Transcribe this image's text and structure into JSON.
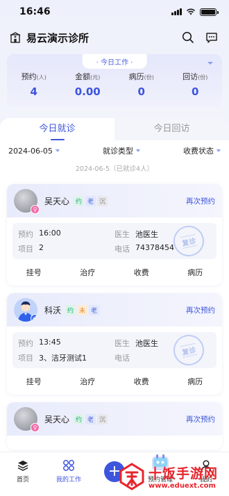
{
  "status_bar": {
    "time": "16:46"
  },
  "header": {
    "clinic_name": "易云演示诊所"
  },
  "summary": {
    "tag": "· 今日工作 ·",
    "stats": [
      {
        "label": "预约",
        "unit": "(人)",
        "value": "4"
      },
      {
        "label": "金额",
        "unit": "(元)",
        "value": "0.00"
      },
      {
        "label": "病历",
        "unit": "(份)",
        "value": "0"
      },
      {
        "label": "回访",
        "unit": "(份)",
        "value": "0"
      }
    ]
  },
  "tabs": [
    {
      "label": "今日就诊"
    },
    {
      "label": "今日回访"
    }
  ],
  "filters": {
    "date": "2024-06-05",
    "visit_type": "就诊类型",
    "charge_status": "收费状态"
  },
  "date_summary": "2024-06-5（已就诊4人）",
  "appointments": [
    {
      "name": "吴天心",
      "gender": "female",
      "tags": [
        "约",
        "老",
        "沉"
      ],
      "rebook": "再次预约",
      "labels": {
        "appt": "预约",
        "doctor": "医生",
        "item": "项目",
        "phone": "电话"
      },
      "appt_time": "16:00",
      "doctor": "池医生",
      "item": "2",
      "phone": "74378454",
      "stamp": "复诊",
      "actions": [
        "挂号",
        "治疗",
        "收费",
        "病历"
      ]
    },
    {
      "name": "科沃",
      "gender": "male",
      "tags": [
        "约",
        "未",
        "老"
      ],
      "rebook": "再次预约",
      "labels": {
        "appt": "预约",
        "doctor": "医生",
        "item": "项目",
        "phone": "电话"
      },
      "appt_time": "13:45",
      "doctor": "池医生",
      "item": "3、洁牙测试1",
      "phone": "",
      "stamp": "复诊",
      "actions": [
        "挂号",
        "治疗",
        "收费",
        "病历"
      ]
    },
    {
      "name": "吴天心",
      "gender": "female",
      "tags": [
        "约",
        "老",
        "沉"
      ],
      "rebook": "再次预约"
    }
  ],
  "bottom_nav": [
    {
      "label": "首页"
    },
    {
      "label": "我的工作"
    },
    {
      "label": ""
    },
    {
      "label": "预约管理"
    },
    {
      "label": "我的"
    }
  ],
  "watermark": {
    "title": "十饭手游网",
    "url": "www.eduext.com"
  },
  "colors": {
    "accent": "#3d55dc",
    "watermark_red": "#e8242d"
  }
}
